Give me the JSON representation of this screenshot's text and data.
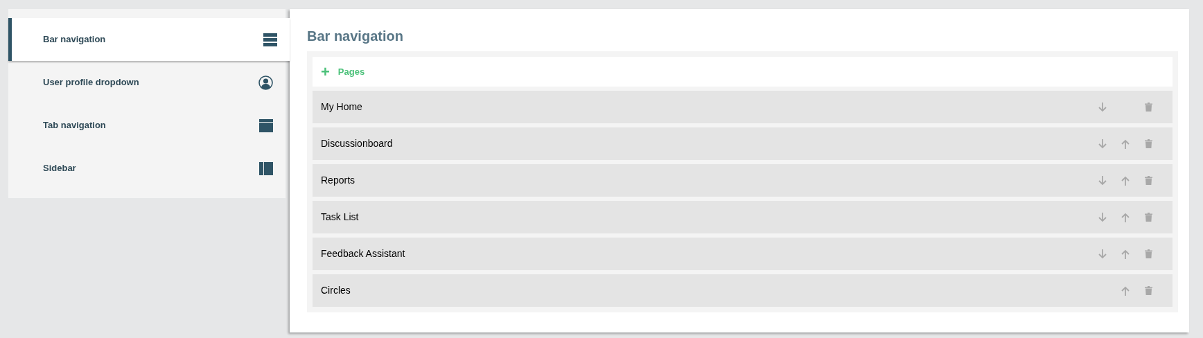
{
  "sidebar": {
    "items": [
      {
        "label": "Bar navigation",
        "kind": "bars",
        "selected": true
      },
      {
        "label": "User profile dropdown",
        "kind": "user",
        "selected": false
      },
      {
        "label": "Tab navigation",
        "kind": "tab",
        "selected": false
      },
      {
        "label": "Sidebar",
        "kind": "sidebar",
        "selected": false
      }
    ]
  },
  "main": {
    "title": "Bar navigation",
    "add_button": {
      "icon": "+",
      "label": "Pages"
    },
    "rows": [
      {
        "label": "My Home",
        "move_down": true,
        "move_up": false
      },
      {
        "label": "Discussionboard",
        "move_down": true,
        "move_up": true
      },
      {
        "label": "Reports",
        "move_down": true,
        "move_up": true
      },
      {
        "label": "Task List",
        "move_down": true,
        "move_up": true
      },
      {
        "label": "Feedback Assistant",
        "move_down": true,
        "move_up": true
      },
      {
        "label": "Circles",
        "move_down": false,
        "move_up": true
      }
    ]
  }
}
